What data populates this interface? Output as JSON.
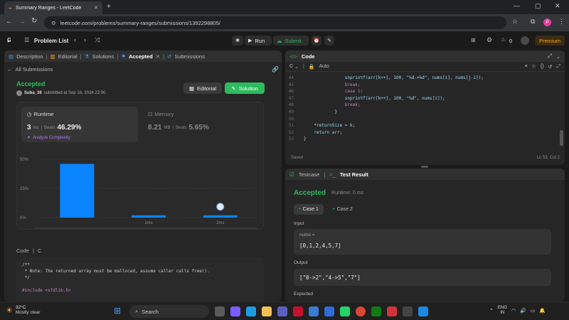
{
  "browser": {
    "tab_title": "Summary Ranges - LeetCode",
    "url": "leetcode.com/problems/summary-ranges/submissions/1392298805/",
    "profile_initial": "P"
  },
  "nav": {
    "problem_list": "Problem List",
    "run": "Run",
    "submit": "Submit",
    "notifications": "0",
    "premium": "Premium"
  },
  "left_tabs": [
    {
      "label": "Description"
    },
    {
      "label": "Editorial"
    },
    {
      "label": "Solutions"
    },
    {
      "label": "Accepted"
    },
    {
      "label": "Submissions"
    }
  ],
  "submission": {
    "back": "All Submissions",
    "status": "Accepted",
    "user": "Suba_38",
    "submitted_at": "submitted at Sep 16, 2024 22:00",
    "editorial_btn": "Editorial",
    "solution_btn": "Solution",
    "runtime_label": "Runtime",
    "runtime_value": "3",
    "runtime_unit": "ms",
    "beats_label": "Beats",
    "runtime_beats": "46.29%",
    "analyze": "Analyze Complexity",
    "memory_label": "Memory",
    "memory_value": "8.21",
    "memory_unit": "MB",
    "memory_beats": "5.65%"
  },
  "chart_data": {
    "type": "bar",
    "categories": [
      "",
      "1ms",
      "2ms"
    ],
    "values": [
      46,
      2,
      2
    ],
    "yticks": [
      "50%",
      "25%",
      "0%"
    ],
    "ylim": [
      0,
      50
    ],
    "mini_labels": [
      "1ms",
      "2ms"
    ]
  },
  "code_bottom": {
    "code_label": "Code",
    "lang": "C",
    "lines": [
      "/**",
      " * Note: The returned array must be malloced, assume caller calls free().",
      " */",
      "",
      "#include <stdlib.h>"
    ]
  },
  "editor": {
    "title": "Code",
    "lang": "C",
    "mode": "Auto",
    "lines": [
      {
        "n": "44",
        "text": "                snprintf(arr[k++], 100, \"%d->%d\", nums[i], nums[j-1]);"
      },
      {
        "n": "45",
        "text": "                break;"
      },
      {
        "n": "46",
        "text": "                case 1:"
      },
      {
        "n": "47",
        "text": "                snprintf(arr[k++], 100, \"%d\", nums[i]);"
      },
      {
        "n": "48",
        "text": "                break;"
      },
      {
        "n": "49",
        "text": "            }"
      },
      {
        "n": "50",
        "text": ""
      },
      {
        "n": "51",
        "text": "    *returnSize = k;"
      },
      {
        "n": "52",
        "text": "    return arr;"
      },
      {
        "n": "53",
        "text": "}"
      }
    ],
    "saved": "Saved",
    "cursor": "Ln 53, Col 2"
  },
  "results": {
    "testcase_tab": "Testcase",
    "result_tab": "Test Result",
    "status": "Accepted",
    "runtime": "Runtime: 0 ms",
    "case1": "Case 1",
    "case2": "Case 2",
    "input_label": "Input",
    "input_var": "nums =",
    "input_value": "[0,1,2,4,5,7]",
    "output_label": "Output",
    "output_value": "[\"0->2\",\"4->5\",\"7\"]",
    "expected_label": "Expected"
  },
  "taskbar": {
    "temp": "32°C",
    "weather": "Mostly clear",
    "search": "Search",
    "lang1": "ENG",
    "lang2": "IN"
  },
  "colors": {
    "accent_green": "#2cbb5d",
    "bar_blue": "#0a84ff",
    "premium": "#ffa116"
  }
}
